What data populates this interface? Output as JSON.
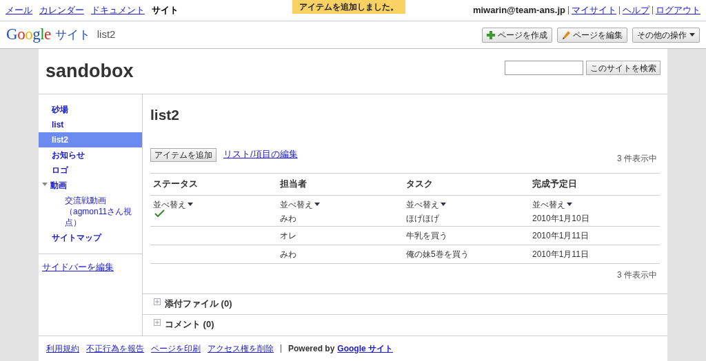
{
  "top_bar": {
    "links": [
      {
        "label": "メール",
        "selected": false
      },
      {
        "label": "カレンダー",
        "selected": false
      },
      {
        "label": "ドキュメント",
        "selected": false
      },
      {
        "label": "サイト",
        "selected": true
      }
    ],
    "notice": "アイテムを追加しました。",
    "user": "miwarin@team-ans.jp",
    "user_links": [
      "マイサイト",
      "ヘルプ",
      "ログアウト"
    ]
  },
  "header": {
    "logo": "Google",
    "product": "サイト",
    "page": "list2",
    "buttons": [
      {
        "label": "ページを作成",
        "kind": "create"
      },
      {
        "label": "ページを編集",
        "kind": "edit"
      },
      {
        "label": "その他の操作",
        "kind": "menu"
      }
    ]
  },
  "site": {
    "title": "sandobox",
    "search_button": "このサイトを検索"
  },
  "sidebar": {
    "items": [
      {
        "label": "砂場",
        "selected": false
      },
      {
        "label": "list",
        "selected": false
      },
      {
        "label": "list2",
        "selected": true
      },
      {
        "label": "お知らせ",
        "selected": false
      },
      {
        "label": "ロゴ",
        "selected": false
      },
      {
        "label": "動画",
        "selected": false,
        "expanded": true,
        "children": [
          {
            "label": "交流戦動画（agmon11さん視点）",
            "selected": false
          }
        ]
      },
      {
        "label": "サイトマップ",
        "selected": false
      }
    ],
    "edit_link": "サイドバーを編集"
  },
  "page": {
    "title": "list2",
    "add_button": "アイテムを追加",
    "edit_link": "リスト/項目の編集",
    "count_top": "3 件表示中",
    "count_bottom": "3 件表示中",
    "table": {
      "columns": [
        {
          "label": "ステータス",
          "sort": "並べ替え"
        },
        {
          "label": "担当者",
          "sort": "並べ替え"
        },
        {
          "label": "タスク",
          "sort": "並べ替え"
        },
        {
          "label": "完成予定日",
          "sort": "並べ替え"
        }
      ],
      "rows": [
        {
          "done": true,
          "owner": "みわ",
          "task": "ほげほげ",
          "due": "2010年1月10日"
        },
        {
          "done": false,
          "owner": "オレ",
          "task": "牛乳を買う",
          "due": "2010年1月11日"
        },
        {
          "done": false,
          "owner": "みわ",
          "task": "俺の妹5巻を買う",
          "due": "2010年1月11日"
        }
      ]
    },
    "sections": [
      {
        "label": "添付ファイル (0)",
        "expanded": false
      },
      {
        "label": "コメント (0)",
        "expanded": false
      }
    ]
  },
  "footer": {
    "links": [
      "利用規約",
      "不正行為を報告",
      "ページを印刷",
      "アクセス権を削除"
    ],
    "powered": "Powered by",
    "brand_link": "Google サイト"
  }
}
